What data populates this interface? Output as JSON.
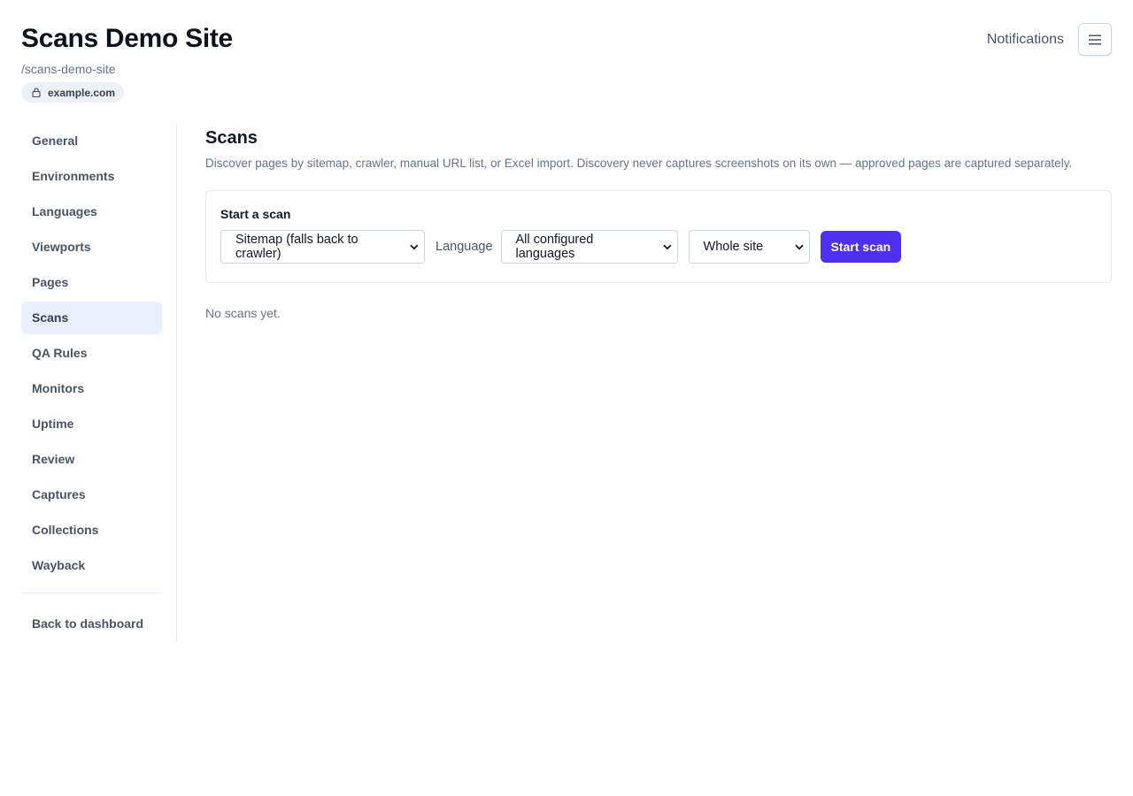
{
  "header": {
    "title": "Scans Demo Site",
    "slug": "/scans-demo-site",
    "domain": "example.com",
    "notifications_label": "Notifications"
  },
  "sidebar": {
    "items": [
      {
        "label": "General"
      },
      {
        "label": "Environments"
      },
      {
        "label": "Languages"
      },
      {
        "label": "Viewports"
      },
      {
        "label": "Pages"
      },
      {
        "label": "Scans",
        "active": true
      },
      {
        "label": "QA Rules"
      },
      {
        "label": "Monitors"
      },
      {
        "label": "Uptime"
      },
      {
        "label": "Review"
      },
      {
        "label": "Captures"
      },
      {
        "label": "Collections"
      },
      {
        "label": "Wayback"
      }
    ],
    "back_label": "Back to dashboard"
  },
  "main": {
    "title": "Scans",
    "description": "Discover pages by sitemap, crawler, manual URL list, or Excel import. Discovery never captures screenshots on its own — approved pages are captured separately.",
    "card": {
      "title": "Start a scan",
      "method_select": "Sitemap (falls back to crawler)",
      "language_label": "Language",
      "language_select": "All configured languages",
      "scope_select": "Whole site",
      "start_button": "Start scan"
    },
    "empty_text": "No scans yet."
  },
  "colors": {
    "accent": "#4f2ff0",
    "active_nav_bg": "#eaeffb"
  },
  "icons": {
    "domain": "lock-icon",
    "menu": "hamburger-menu-icon",
    "select": "chevron-down-icon"
  }
}
